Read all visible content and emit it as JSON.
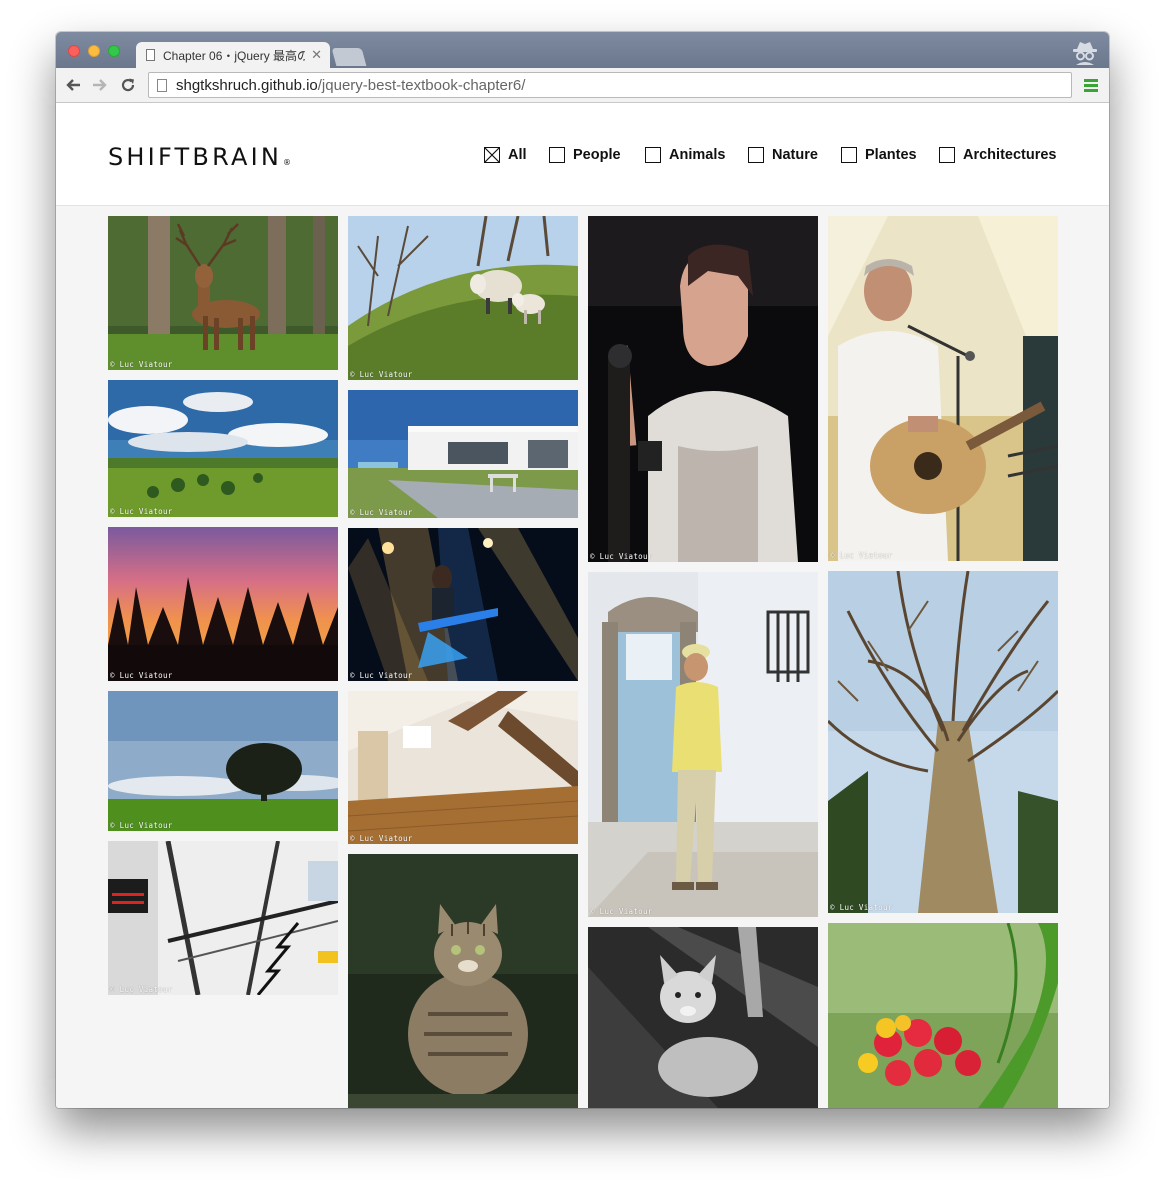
{
  "browser": {
    "tab_title": "Chapter 06・jQuery 最高の…",
    "url_host": "shgtkshruch.github.io",
    "url_path": "/jquery-best-textbook-chapter6/"
  },
  "site": {
    "logo": "SHIFTBRAIN",
    "logo_mark": "®",
    "filters": [
      {
        "label": "All",
        "checked": true
      },
      {
        "label": "People",
        "checked": false
      },
      {
        "label": "Animals",
        "checked": false
      },
      {
        "label": "Nature",
        "checked": false
      },
      {
        "label": "Plantes",
        "checked": false
      },
      {
        "label": "Architectures",
        "checked": false
      }
    ]
  },
  "gallery": {
    "credit": "© Luc Viatour",
    "photos": [
      {
        "name": "photo-deer"
      },
      {
        "name": "photo-meadow-sky"
      },
      {
        "name": "photo-sunset-trees"
      },
      {
        "name": "photo-lone-tree"
      },
      {
        "name": "photo-staircase"
      },
      {
        "name": "photo-sheep"
      },
      {
        "name": "photo-modern-house"
      },
      {
        "name": "photo-guitarist-stage"
      },
      {
        "name": "photo-attic-room"
      },
      {
        "name": "photo-wildcat"
      },
      {
        "name": "photo-singer-woman"
      },
      {
        "name": "photo-man-yellow-shirt"
      },
      {
        "name": "photo-lynx"
      },
      {
        "name": "photo-singer-guitar"
      },
      {
        "name": "photo-tree-from-below"
      },
      {
        "name": "photo-red-flowers"
      }
    ]
  }
}
